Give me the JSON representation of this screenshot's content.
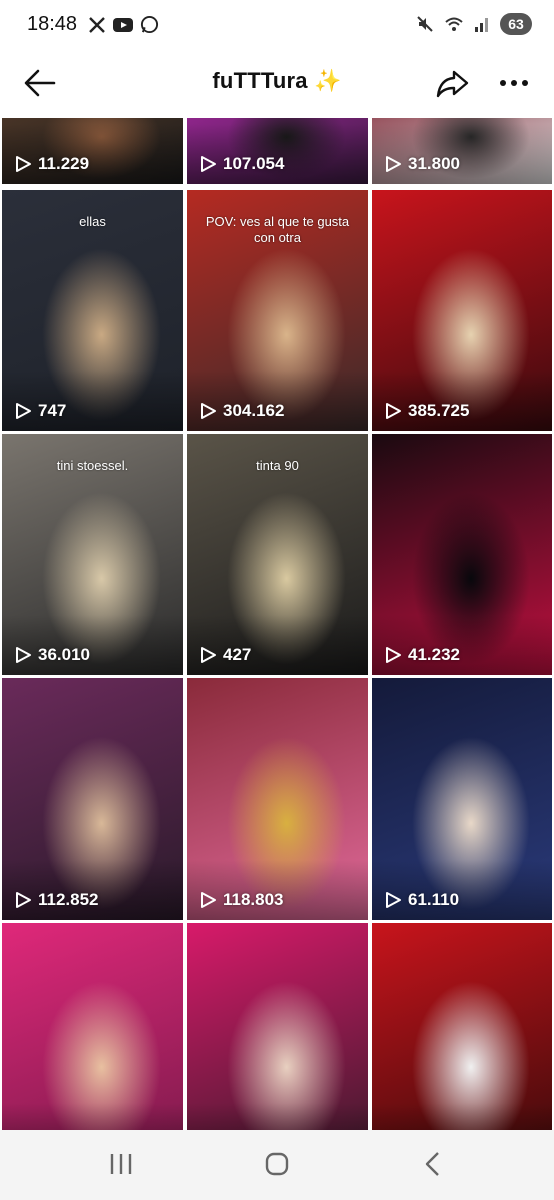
{
  "status_bar": {
    "time": "18:48",
    "battery": "63",
    "app_icons": [
      "x-icon",
      "youtube-icon",
      "whatsapp-icon"
    ],
    "right_icons": [
      "mute-icon",
      "wifi-icon",
      "signal-icon"
    ]
  },
  "header": {
    "title": "fuTTTura ✨"
  },
  "grid": {
    "tiles": [
      {
        "views": "11.229",
        "caption": "",
        "colors": [
          "#5a3e2b",
          "#1a1a1a",
          "#8b5a3c"
        ]
      },
      {
        "views": "107.054",
        "caption": "",
        "colors": [
          "#b02aa8",
          "#3a1a40",
          "#1a1a1a"
        ]
      },
      {
        "views": "31.800",
        "caption": "",
        "colors": [
          "#7a1a2a",
          "#e0e0e0",
          "#2a2a2a"
        ]
      },
      {
        "views": "747",
        "caption": "ellas",
        "colors": [
          "#2b2f3a",
          "#1e222a",
          "#c9a983"
        ]
      },
      {
        "views": "304.162",
        "caption": "POV: ves al que te gusta con otra",
        "colors": [
          "#b52a22",
          "#3a2a2a",
          "#d9b48a"
        ]
      },
      {
        "views": "385.725",
        "caption": "",
        "colors": [
          "#c8141c",
          "#3a0a0e",
          "#e6d2b0"
        ]
      },
      {
        "views": "36.010",
        "caption": "tini stoessel.",
        "colors": [
          "#7a756e",
          "#2a2a2a",
          "#d8c8a8"
        ]
      },
      {
        "views": "427",
        "caption": "tinta 90",
        "colors": [
          "#5a5448",
          "#1a1a1a",
          "#d9c9a0"
        ]
      },
      {
        "views": "41.232",
        "caption": "",
        "colors": [
          "#1a0a10",
          "#c01040",
          "#08080c"
        ]
      },
      {
        "views": "112.852",
        "caption": "",
        "colors": [
          "#6a2a5a",
          "#2a1a2a",
          "#d8b898"
        ]
      },
      {
        "views": "118.803",
        "caption": "",
        "colors": [
          "#8a2a3a",
          "#e06a9a",
          "#d8b040"
        ]
      },
      {
        "views": "61.110",
        "caption": "",
        "colors": [
          "#141a3a",
          "#2a3a7a",
          "#e8d8c8"
        ]
      },
      {
        "views": "",
        "caption": "",
        "colors": [
          "#e0287a",
          "#7a1a4a",
          "#e8c0a0"
        ]
      },
      {
        "views": "",
        "caption": "",
        "colors": [
          "#d81a6a",
          "#3a1a2a",
          "#e8d0c0"
        ]
      },
      {
        "views": "",
        "caption": "",
        "colors": [
          "#c8141c",
          "#3a0a0a",
          "#f0f0f0"
        ]
      }
    ]
  },
  "nav": {
    "icons": [
      "recent-apps-icon",
      "home-icon",
      "back-nav-icon"
    ]
  }
}
